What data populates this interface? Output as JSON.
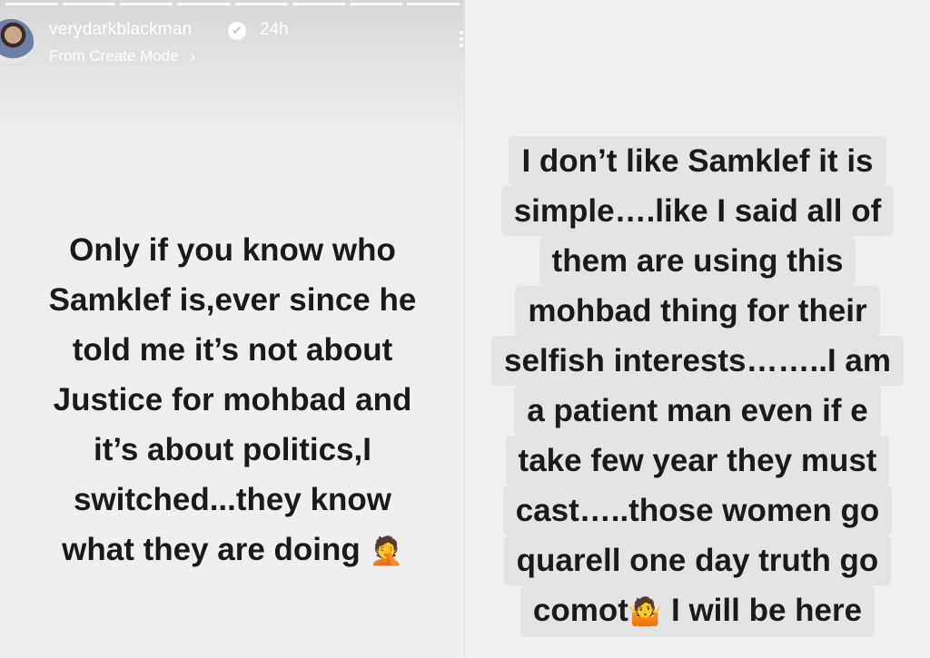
{
  "left_story": {
    "username": "verydarkblackman",
    "verified_mark": "✔",
    "time_ago": "24h",
    "subtitle": "From Create Mode",
    "subtitle_chevron": "›",
    "lines": [
      "Only if you know who",
      "Samklef is,ever since he",
      "told me it’s not about",
      "Justice for mohbad and",
      "it’s about politics,I",
      "switched...they know",
      "what they are doing"
    ],
    "end_emoji": "🤦"
  },
  "right_story": {
    "lines": [
      "I don’t like Samklef it is",
      "simple….like I said all of",
      "them are using this",
      "mohbad thing for their",
      "selfish interests……..I am",
      "a patient man even if e",
      "take few year they must",
      "cast…..those women go",
      "quarell one day truth go"
    ],
    "last_line_start": "comot",
    "last_line_emoji": "🤷",
    "last_line_end": " I will be here"
  },
  "colors": {
    "story_bg": "#efefef",
    "text_highlight": "#e4e4e4",
    "text": "#1a1a1a"
  },
  "icons": [
    "avatar",
    "verified-badge-icon",
    "chevron-right-icon",
    "more-options-icon",
    "facepalm-emoji",
    "shrug-emoji"
  ]
}
